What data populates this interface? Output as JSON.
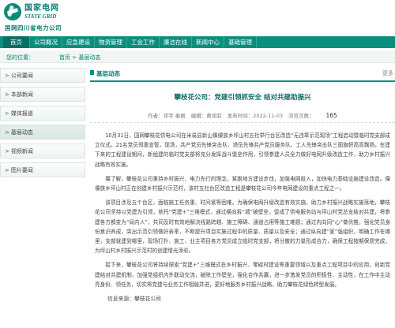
{
  "header": {
    "logo_cn": "国家电网",
    "logo_en": "STATE GRID",
    "company": "国网四川省电力公司"
  },
  "nav": {
    "items": [
      "首页",
      "公司概况",
      "应急建设",
      "物资管理",
      "工会工作",
      "廉洁在线",
      "新闻中心",
      "基础管理"
    ]
  },
  "breadcrumb": {
    "label": "您的位置：",
    "path_home": "首页",
    "path_sep": " > ",
    "path_current": "基层动态"
  },
  "sidebar": {
    "items": [
      "公司要闻",
      "本部新闻",
      "媒体报道",
      "基层动态",
      "视频新闻",
      "图片要闻"
    ],
    "active_index": 3
  },
  "main": {
    "tab": "基层动态",
    "more": "更多",
    "title": "攀枝花公司：党建引领抓安全 结对共建助振兴",
    "meta": {
      "author": "作者：邓宇 秦丽",
      "editor": "编辑：黄翊菲",
      "time": "发布时间：2022-11-03",
      "views_label": "浏览次数：",
      "views": "165"
    },
    "paragraphs": [
      "10月31日，国网攀枝花供电公司在米易县新山傈僳族乡坪山村五社举行台区改造“无违章示范现场”工程启动暨临时党支部成立仪式。21名党员郑重宣誓。现场，共产党员先锋突击队、退伍先锋共产党员服务队、工人先锋突击队三面旗帜高高飘扬。在建下来的工程建设期间，新组建的临时党支部将充分发挥战斗堡垒作用，引领参建人员全力做好电网升级改造工作，助力乡村振兴战略有效实施。",
      "攥了解，攀枝花公司秉持乡村振兴、电力先行的理念，紧跟地方建设步伐，加强电网投入，加快电力基础设施建设改造。傈僳族乡坪山村正在创建乡村振兴示范村，该村五社台区改造工程是攀枝花公司今年电网建设的重点工程之一。",
      "该项目涉及五个台区，面临施工任务重、时间紧等困难。为确保电网升级改造有效实施，助力乡村振兴战略实施落地，攀枝花公司坚持以党建为引领，依托“党建+”三维模式，通过横向拆“墙”破壁垒，促成了供电服务站与坪山村党总支结对共建，将参建各方都变为“局内人”，共同及时有效地解决线路跨越、施工障碍、通道占用等施工难题；通过内向同“心”做优推，强化党员身份意识养成，突出示范引领做好表率，不断提升项目实施过程中的质量、质量以及安全；通过纵向建“家”强组织，明确工作在哪里，支部就建到哪里，现场打扑、施工、业主项目各方党员成立临时党支部，将分散的力量形成合力，确保工程按期保质完成，为坪山村乡村振兴示范村的创建增光添彩。",
      "接下来，攀枝花公司将持续探索“党建+”三维模式在乡村振兴、零碳村建设等重要领域以及重点工程项目中的应用，创新党建结对共建机制，加强党组织内外联动交流，破除工作壁垒，强化合作共赢，进一步激发党员的积极性、主动性，在工作中主动亮身份、领任务，切实将党建与业务工作相融并进，更好地服务乡村振兴战略，助力攀枝花绿色转型发展。"
    ],
    "source": "信息来源：攀枝花公司"
  },
  "colors": {
    "brand": "#0b8f7d",
    "brand_dark": "#077062",
    "crumb_bg": "#f1f5f3"
  },
  "icons": {
    "sidebar_arrow": "chevron-right-icon",
    "logo": "state-grid-logo"
  }
}
